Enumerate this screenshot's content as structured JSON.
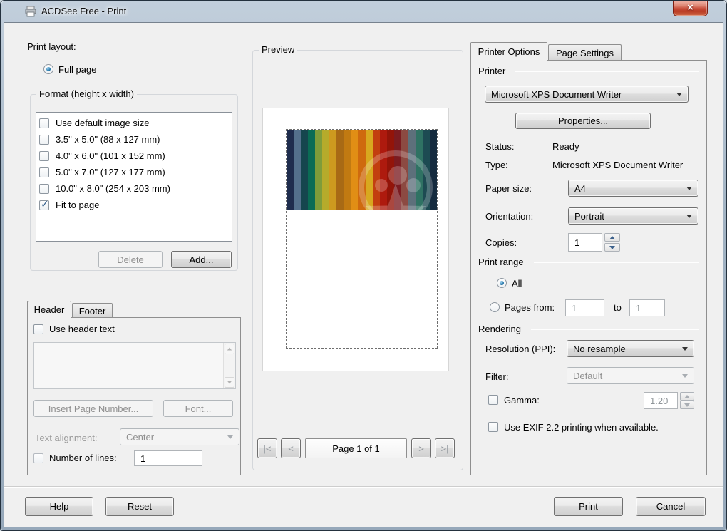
{
  "window": {
    "title": "ACDSee Free - Print",
    "close_glyph": "×"
  },
  "left": {
    "print_layout_label": "Print layout:",
    "full_page": {
      "label": "Full page",
      "checked": true
    },
    "format": {
      "legend": "Format (height x width)",
      "items": [
        {
          "label": "Use default image size",
          "checked": false
        },
        {
          "label": "3.5\" x 5.0\" (88 x 127 mm)",
          "checked": false
        },
        {
          "label": "4.0\" x 6.0\" (101 x 152 mm)",
          "checked": false
        },
        {
          "label": "5.0\" x 7.0\" (127 x 177 mm)",
          "checked": false
        },
        {
          "label": "10.0\" x 8.0\" (254 x 203 mm)",
          "checked": false
        },
        {
          "label": "Fit to page",
          "checked": true
        }
      ],
      "delete_label": "Delete",
      "add_label": "Add..."
    },
    "header_footer": {
      "tab_header": "Header",
      "tab_footer": "Footer",
      "use_header_text": {
        "label": "Use header text",
        "checked": false
      },
      "header_text_value": "",
      "insert_page_number_label": "Insert Page Number...",
      "font_label": "Font...",
      "text_alignment_label": "Text alignment:",
      "text_alignment_value": "Center",
      "number_of_lines": {
        "label": "Number of lines:",
        "checked": false,
        "value": "1"
      }
    }
  },
  "preview": {
    "legend": "Preview",
    "image_stripes": [
      "#1f2d4e",
      "#54708c",
      "#15464e",
      "#0a6c55",
      "#7e9c3a",
      "#b5ab2b",
      "#cd9a1f",
      "#a86a15",
      "#c17a12",
      "#e18e15",
      "#cf6a0e",
      "#d8a81f",
      "#c23f0f",
      "#ae1a0e",
      "#931409",
      "#7c1b20",
      "#8c4a42",
      "#5d707b",
      "#2f7263",
      "#1d4b52",
      "#152b3f"
    ],
    "watermark": "acdsee-logo",
    "pager": {
      "first": "|<",
      "prev": "<",
      "label": "Page 1 of 1",
      "next": ">",
      "last": ">|"
    }
  },
  "right": {
    "tab_printer_options": "Printer Options",
    "tab_page_settings": "Page Settings",
    "printer_section": "Printer",
    "printer_value": "Microsoft XPS Document Writer",
    "properties_label": "Properties...",
    "status_label": "Status:",
    "status_value": "Ready",
    "type_label": "Type:",
    "type_value": "Microsoft XPS Document Writer",
    "paper_size_label": "Paper size:",
    "paper_size_value": "A4",
    "orientation_label": "Orientation:",
    "orientation_value": "Portrait",
    "copies_label": "Copies:",
    "copies_value": "1",
    "print_range_section": "Print range",
    "all": {
      "label": "All",
      "checked": true
    },
    "pages_from": {
      "label": "Pages from:",
      "checked": false,
      "from_value": "1",
      "to_label": "to",
      "to_value": "1"
    },
    "rendering_section": "Rendering",
    "resolution_label": "Resolution (PPI):",
    "resolution_value": "No resample",
    "filter_label": "Filter:",
    "filter_value": "Default",
    "gamma": {
      "label": "Gamma:",
      "checked": false,
      "value": "1.20"
    },
    "exif": {
      "label": "Use EXIF 2.2 printing when available.",
      "checked": false
    }
  },
  "footer": {
    "help": "Help",
    "reset": "Reset",
    "print": "Print",
    "cancel": "Cancel"
  }
}
